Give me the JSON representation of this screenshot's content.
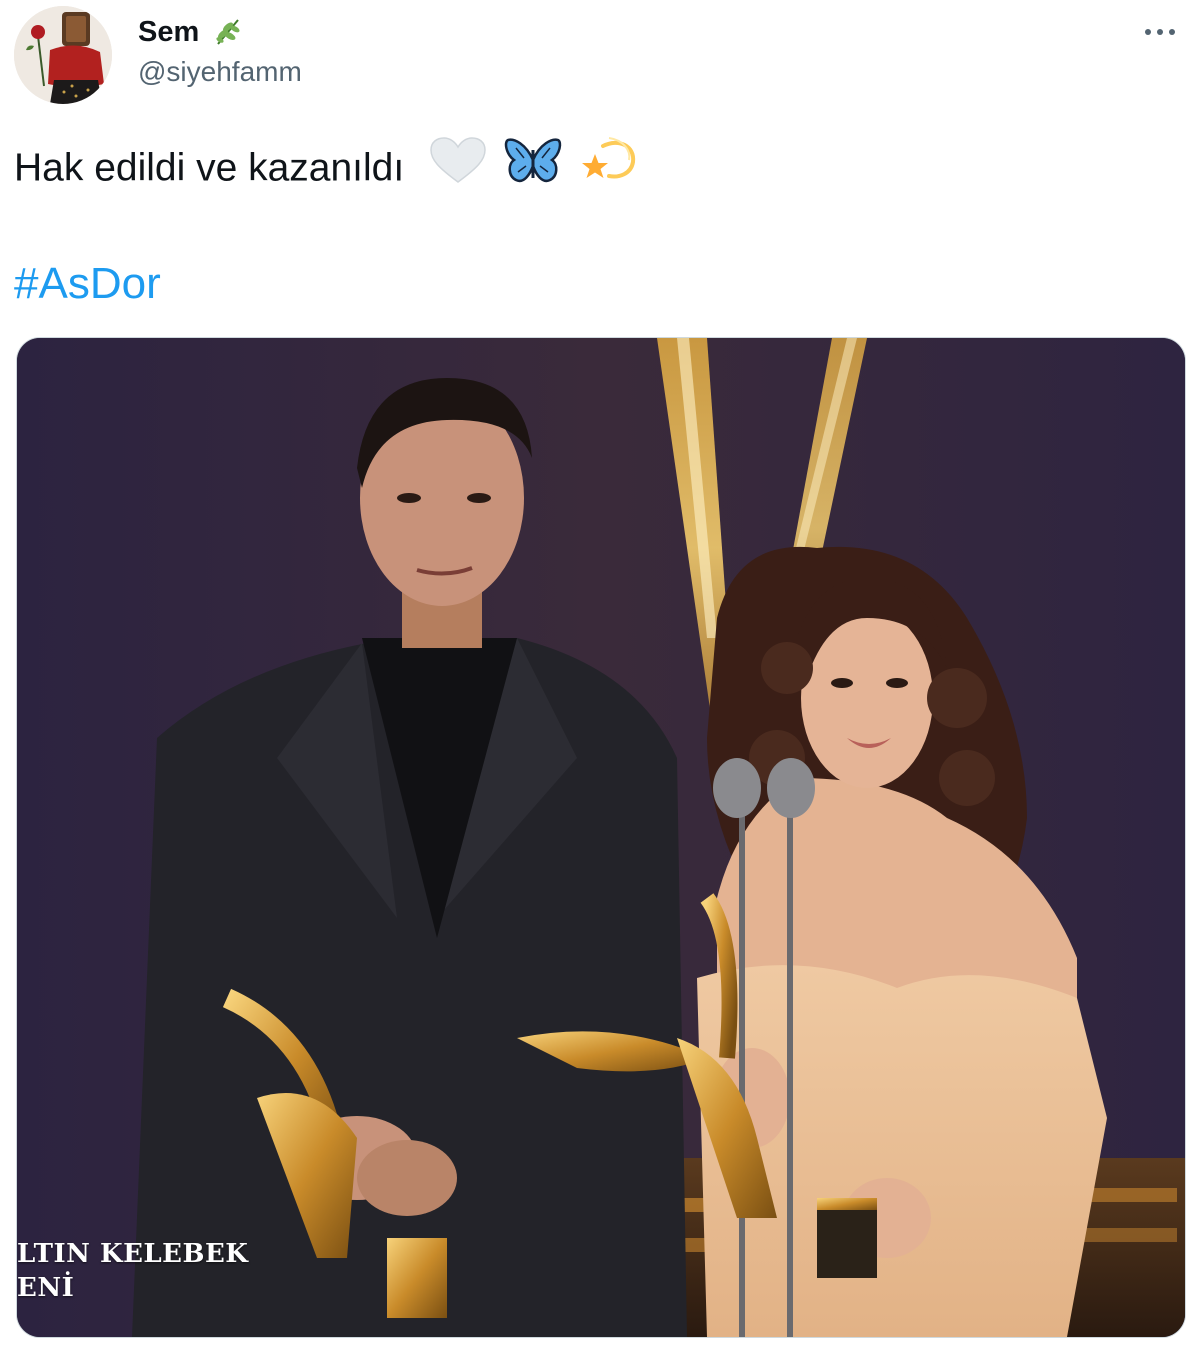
{
  "author": {
    "display_name": "Sem",
    "name_emoji": "herb-emoji",
    "handle": "@siyehfamm",
    "avatar": "avatar-woman-holding-rose"
  },
  "tweet": {
    "text": "Hak edildi ve kazanıldı",
    "emojis": [
      "white-heart-emoji",
      "butterfly-emoji",
      "dizzy-star-emoji"
    ],
    "hashtag": "#AsDor"
  },
  "media": {
    "description_icon": "photo",
    "overlay_caption_line1": "LTIN KELEBEK",
    "overlay_caption_line2": "ENİ"
  },
  "colors": {
    "link": "#1d9bf0",
    "secondary_text": "#536471",
    "border": "#cfd9de"
  }
}
